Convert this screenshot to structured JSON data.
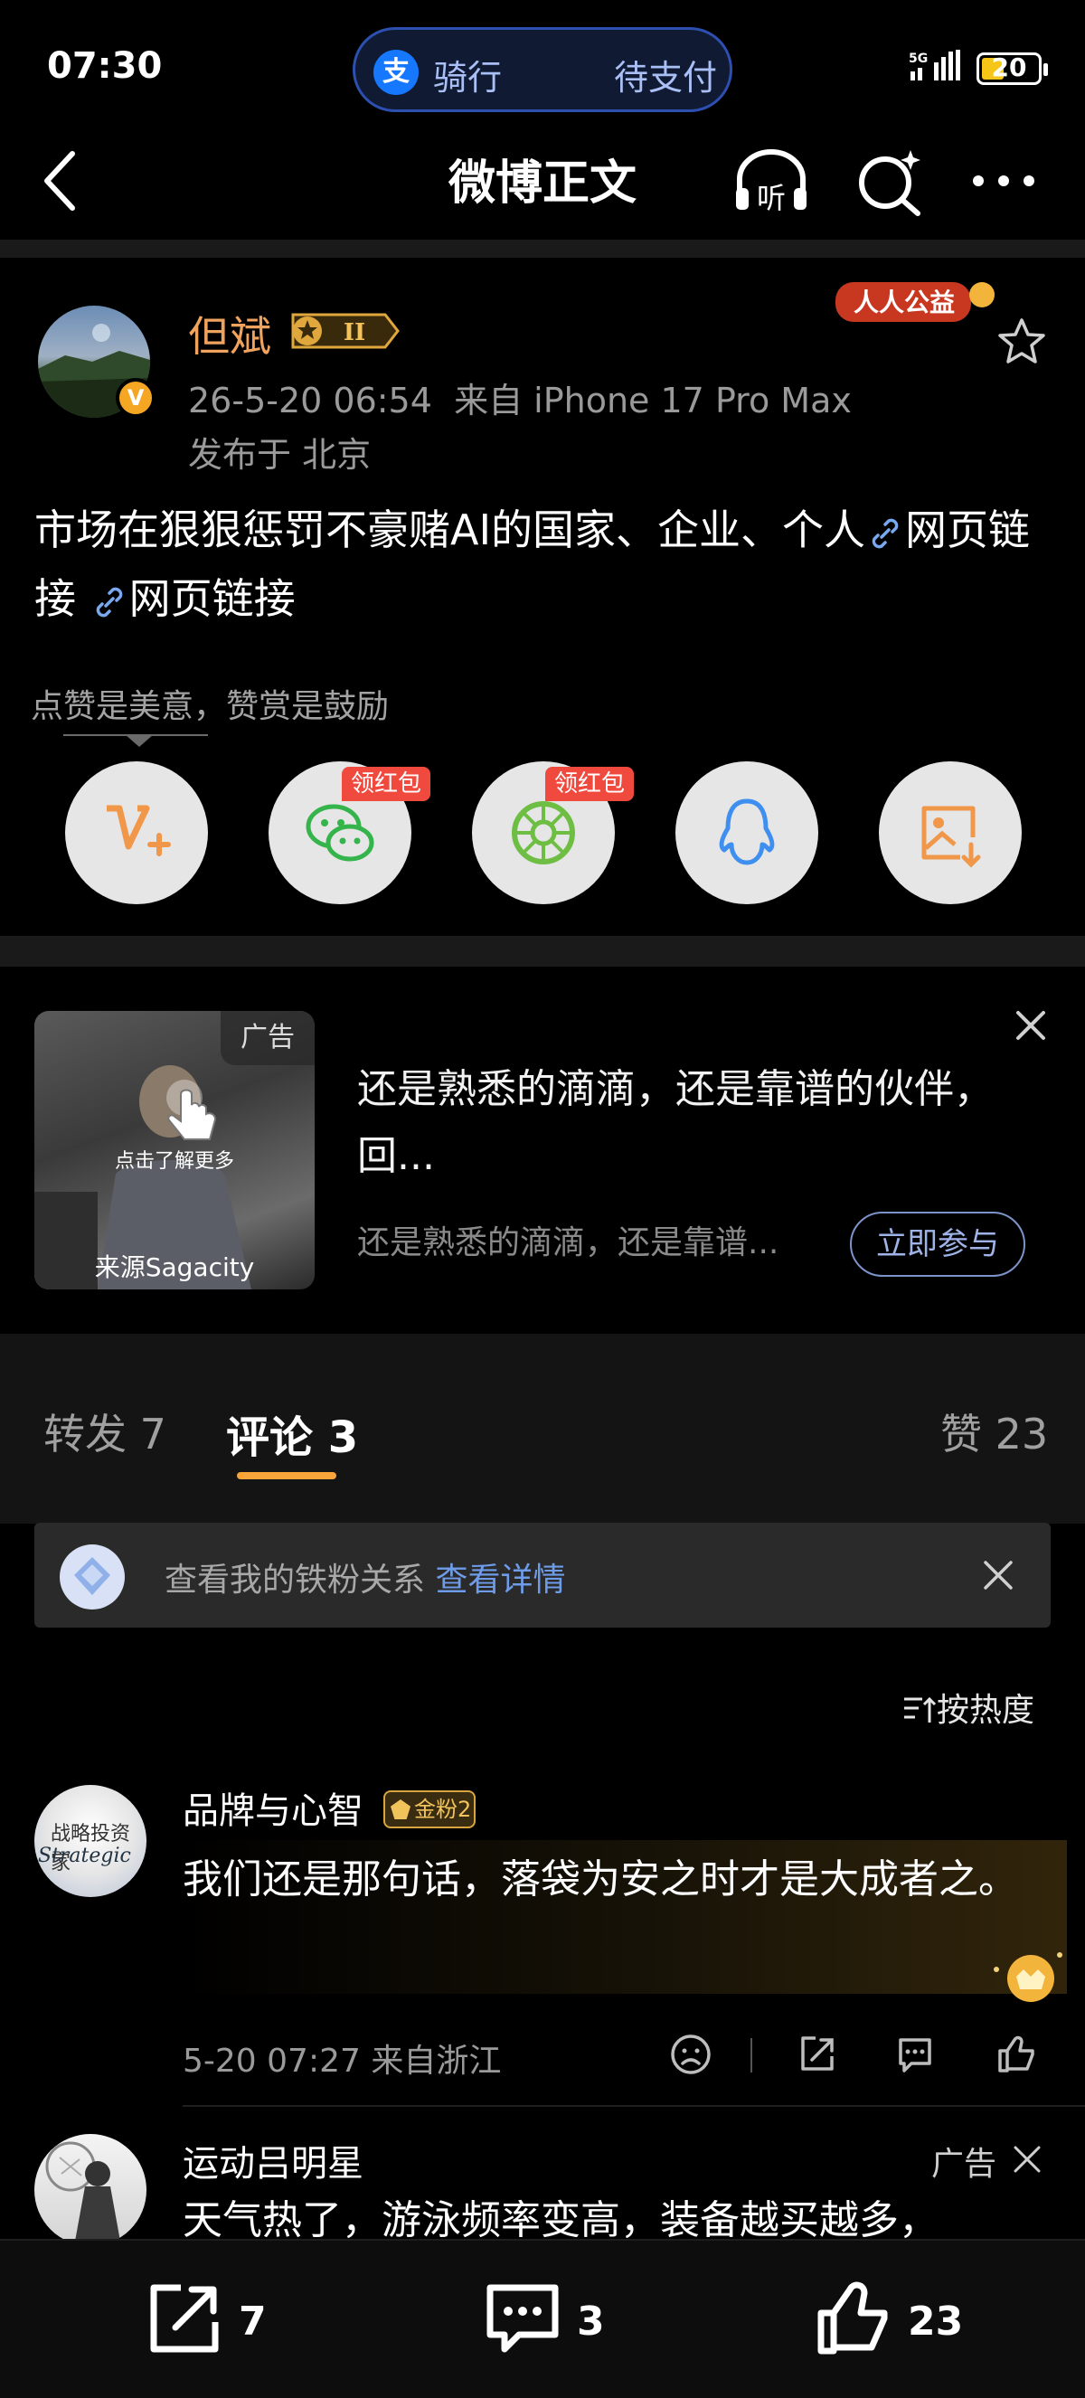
{
  "status_bar": {
    "time": "07:30",
    "pill_icon": "支",
    "pill_ride": "骑行",
    "pill_pay": "待支付",
    "network": "5G",
    "battery": "20"
  },
  "nav": {
    "title": "微博正文",
    "listen_label": "听"
  },
  "post": {
    "author": "但斌",
    "level_badge": "II",
    "time": "26-5-20 06:54",
    "source": "来自 iPhone 17 Pro Max",
    "location": "发布于 北京",
    "charity_badge": "人人公益",
    "text": "市场在狠狠惩罚不豪赌AI的国家、企业、个人",
    "link1": "网页链接",
    "link2": "网页链接",
    "reward_tip": "点赞是美意，赞赏是鼓励",
    "hongbao_label": "领红包"
  },
  "ad": {
    "tag": "广告",
    "hint": "点击了解更多",
    "source": "来源Sagacity",
    "title": "还是熟悉的滴滴，还是靠谱的伙伴，回...",
    "subtitle": "还是熟悉的滴滴，还是靠谱...",
    "button": "立即参与"
  },
  "tabs": {
    "repost": "转发 7",
    "comment": "评论 3",
    "like": "赞 23"
  },
  "fan_card": {
    "text": "查看我的铁粉关系",
    "link": "查看详情"
  },
  "sort_label": "按热度",
  "comments": [
    {
      "name": "品牌与心智",
      "badge": "金粉2",
      "avatar_line1": "战略投资家",
      "avatar_line2": "Strategic",
      "text": "我们还是那句话，落袋为安之时才是大成者之。",
      "meta": "5-20 07:27  来自浙江"
    },
    {
      "name": "运动吕明星",
      "ad_tag": "广告",
      "text": "天气热了，游泳频率变高，装备越买越多，"
    }
  ],
  "bottom_bar": {
    "repost": "7",
    "comment": "3",
    "like": "23"
  },
  "colors": {
    "accent_orange": "#f7a53a",
    "author_name": "#f0a35e",
    "link_blue": "#6e9ce8",
    "hongbao_red": "#f04a3f"
  }
}
